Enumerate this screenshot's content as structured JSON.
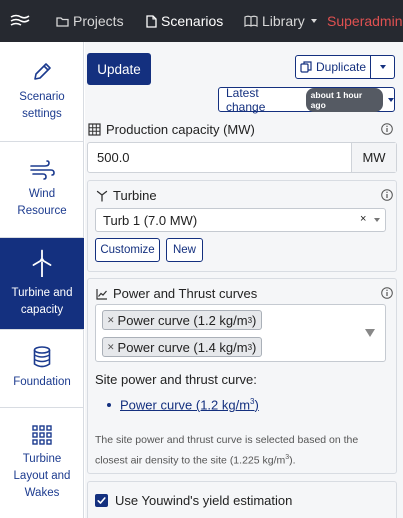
{
  "navbar": {
    "projects": "Projects",
    "scenarios": "Scenarios",
    "library": "Library",
    "user": "Superadmin"
  },
  "sidebar": {
    "items": [
      {
        "label1": "Scenario",
        "label2": "settings",
        "icon": "pencil-icon"
      },
      {
        "label1": "Wind",
        "label2": "Resource",
        "icon": "wind-icon"
      },
      {
        "label1": "Turbine and",
        "label2": "capacity",
        "icon": "turbine-icon",
        "active": true
      },
      {
        "label1": "Foundation",
        "icon": "database-icon"
      },
      {
        "label1": "Turbine",
        "label2": "Layout and",
        "label3": "Wakes",
        "icon": "grid-icon"
      }
    ]
  },
  "toolbar": {
    "update": "Update",
    "duplicate": "Duplicate",
    "latest_change": "Latest change",
    "latest_badge": "about 1 hour ago"
  },
  "production": {
    "label": "Production capacity (MW)",
    "value": "500.0",
    "unit": "MW"
  },
  "turbine": {
    "label": "Turbine",
    "selected": "Turb 1 (7.0 MW)",
    "clear": "×",
    "customize": "Customize",
    "new": "New"
  },
  "curves": {
    "label": "Power and Thrust curves",
    "tags": [
      {
        "text": "Power curve (1.2 kg/m",
        "sup": "3",
        "close": ")"
      },
      {
        "text": "Power curve (1.4 kg/m",
        "sup": "3",
        "close": ")"
      }
    ],
    "site_label": "Site power and thrust curve:",
    "site_link": {
      "text": "Power curve (1.2 kg/m",
      "sup": "3",
      "close": ")"
    },
    "note_a": "The site power and thrust curve is selected based on the closest air density to the site (1.225 kg/m",
    "note_sup": "3",
    "note_b": ")."
  },
  "youwind": {
    "label": "Use Youwind's yield estimation",
    "checked": true
  },
  "colors": {
    "navbar": "#262930",
    "brand": "#14307f",
    "user": "#e05151",
    "panel": "#f5f6f8"
  }
}
